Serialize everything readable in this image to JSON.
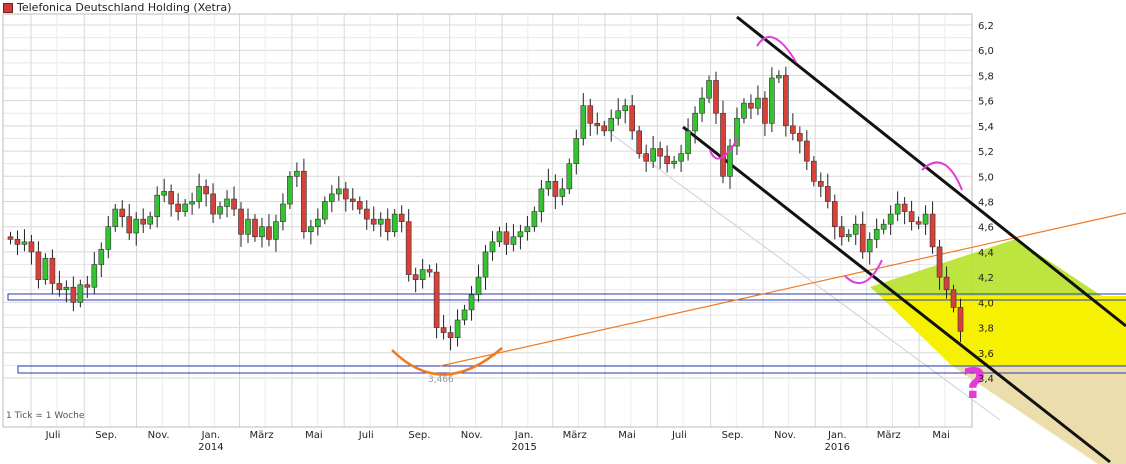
{
  "chart_data": {
    "type": "candlestick",
    "title": "Telefonica Deutschland Holding (Xetra)",
    "tick_note": "1 Tick = 1 Woche",
    "price_axis_side": "right",
    "ylim": [
      3.33,
      6.28
    ],
    "y_ticks": [
      "6,2",
      "6,0",
      "5,8",
      "5,6",
      "5,4",
      "5,2",
      "5,0",
      "4,8",
      "4,6",
      "4,4",
      "4,2",
      "4,0",
      "3,8",
      "3,6",
      "3,4"
    ],
    "x_start": "2013-06-03",
    "x_end": "2016-06-27",
    "month_labels": [
      {
        "date": "2013-07-01",
        "label": "Juli"
      },
      {
        "date": "2013-09-01",
        "label": "Sep."
      },
      {
        "date": "2013-11-01",
        "label": "Nov."
      },
      {
        "date": "2014-01-01",
        "label": "Jan.",
        "year": "2014"
      },
      {
        "date": "2014-03-01",
        "label": "März"
      },
      {
        "date": "2014-05-01",
        "label": "Mai"
      },
      {
        "date": "2014-07-01",
        "label": "Juli"
      },
      {
        "date": "2014-09-01",
        "label": "Sep."
      },
      {
        "date": "2014-11-01",
        "label": "Nov."
      },
      {
        "date": "2015-01-01",
        "label": "Jan.",
        "year": "2015"
      },
      {
        "date": "2015-03-01",
        "label": "März"
      },
      {
        "date": "2015-05-01",
        "label": "Mai"
      },
      {
        "date": "2015-07-01",
        "label": "Juli"
      },
      {
        "date": "2015-09-01",
        "label": "Sep."
      },
      {
        "date": "2015-11-01",
        "label": "Nov."
      },
      {
        "date": "2016-01-01",
        "label": "Jan.",
        "year": "2016"
      },
      {
        "date": "2016-03-01",
        "label": "März"
      },
      {
        "date": "2016-05-01",
        "label": "Mai"
      }
    ],
    "low_label": "3,466",
    "annotation_mark": "?",
    "closes": [
      4.5,
      4.46,
      4.48,
      4.4,
      4.18,
      4.35,
      4.15,
      4.1,
      4.12,
      4.0,
      4.14,
      4.12,
      4.3,
      4.42,
      4.6,
      4.74,
      4.68,
      4.55,
      4.66,
      4.62,
      4.68,
      4.85,
      4.88,
      4.78,
      4.72,
      4.78,
      4.8,
      4.92,
      4.86,
      4.7,
      4.76,
      4.82,
      4.74,
      4.54,
      4.66,
      4.52,
      4.6,
      4.5,
      4.64,
      4.78,
      5.0,
      5.04,
      4.56,
      4.6,
      4.66,
      4.8,
      4.86,
      4.9,
      4.82,
      4.8,
      4.74,
      4.66,
      4.62,
      4.66,
      4.56,
      4.7,
      4.64,
      4.22,
      4.18,
      4.26,
      4.24,
      3.8,
      3.76,
      3.72,
      3.86,
      3.94,
      4.06,
      4.2,
      4.4,
      4.48,
      4.56,
      4.46,
      4.52,
      4.56,
      4.6,
      4.72,
      4.9,
      4.96,
      4.84,
      4.9,
      5.1,
      5.3,
      5.56,
      5.42,
      5.4,
      5.36,
      5.46,
      5.52,
      5.56,
      5.36,
      5.18,
      5.12,
      5.22,
      5.16,
      5.1,
      5.12,
      5.18,
      5.36,
      5.5,
      5.62,
      5.76,
      5.5,
      5.0,
      5.24,
      5.46,
      5.58,
      5.54,
      5.62,
      5.42,
      5.78,
      5.8,
      5.4,
      5.34,
      5.28,
      5.12,
      4.96,
      4.92,
      4.8,
      4.6,
      4.52,
      4.54,
      4.62,
      4.4,
      4.5,
      4.58,
      4.62,
      4.7,
      4.78,
      4.72,
      4.64,
      4.62,
      4.7,
      4.44,
      4.2,
      4.1,
      3.96,
      3.77
    ]
  }
}
